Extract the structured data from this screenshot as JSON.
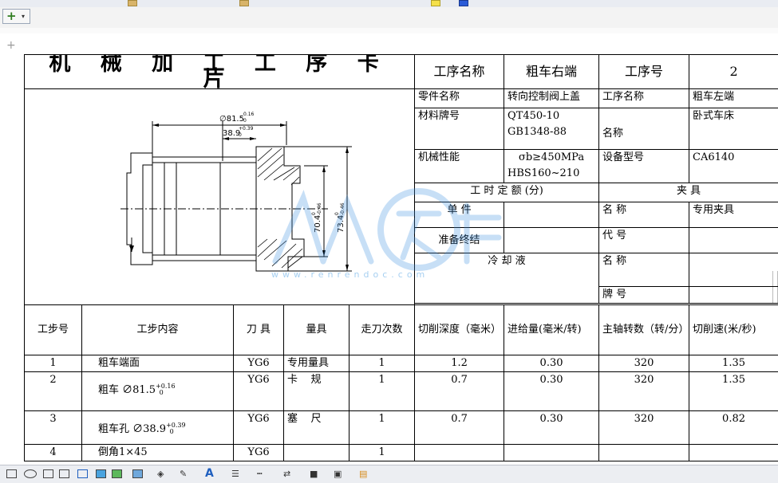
{
  "toolbar": {
    "add_label": "+",
    "dropdown_caret": "▾"
  },
  "card": {
    "title": "机 械 加 工 工 序 卡 片",
    "header": {
      "proc_name_label": "工序名称",
      "proc_name_value": "粗车右端",
      "proc_no_label": "工序号",
      "proc_no_value": "2"
    },
    "rows": {
      "part_name_label": "零件名称",
      "part_name_value": "转向控制阀上盖",
      "proc_name2_label": "工序名称",
      "proc_name2_value": "粗车左端",
      "material_label": "材料牌号",
      "material_value1": "QT450-10",
      "material_value2": "GB1348-88",
      "name_label": "名称",
      "name_value": "卧式车床",
      "mech_label": "机械性能",
      "mech_value1": "σb≥450MPa",
      "mech_value2": "HBS160~210",
      "equip_label": "设备型号",
      "equip_value": "CA6140",
      "time_quota": "工 时 定 额 (分)",
      "fixture": "夹 具",
      "unit_label": "单 件",
      "fixture_name_label": "名 称",
      "fixture_name_value": "专用夹具",
      "prep_label": "准备终结",
      "code_label": "代 号",
      "coolant_label": "冷 却 液",
      "name3_label": "名 称",
      "brand_label": "牌 号"
    },
    "drawing": {
      "dim_outer": "∅81.5",
      "dim_outer_tol": "0.16",
      "dim_outer_tol_low": "0",
      "dim_bore": "38.9",
      "dim_bore_tol": "+0.39",
      "dim_bore_tol_low": "0",
      "dim_h1": "70.4",
      "dim_h1_tol": "-0.46",
      "dim_h2": "73.4",
      "dim_h2_tol": "-0.46",
      "dim_tol_low": "0"
    },
    "step_headers": [
      "工步号",
      "工步内容",
      "刀 具",
      "量具",
      "走刀次数",
      "切削深度（毫米）",
      "进给量(毫米/转)",
      "主轴转数（转/分）",
      "切削速(米/秒)"
    ],
    "steps": [
      {
        "no": "1",
        "content": "粗车端面",
        "tol": "",
        "tol_low": "",
        "tool": "YG6",
        "gauge": "专用量具",
        "passes": "1",
        "depth": "1.2",
        "feed": "0.30",
        "rpm": "320",
        "speed": "1.35"
      },
      {
        "no": "2",
        "content": "粗车 ∅81.5",
        "tol": "+0.16",
        "tol_low": "0",
        "tool": "YG6",
        "gauge": "卡    规",
        "passes": "1",
        "depth": "0.7",
        "feed": "0.30",
        "rpm": "320",
        "speed": "1.35"
      },
      {
        "no": "3",
        "content": "粗车孔 ∅38.9",
        "tol": "+0.39",
        "tol_low": "0",
        "tool": "YG6",
        "gauge": "塞    尺",
        "passes": "1",
        "depth": "0.7",
        "feed": "0.30",
        "rpm": "320",
        "speed": "0.82"
      },
      {
        "no": "4",
        "content": "倒角1×45",
        "tol": "",
        "tol_low": "",
        "tool": "YG6",
        "gauge": "",
        "passes": "1",
        "depth": "",
        "feed": "",
        "rpm": "",
        "speed": ""
      }
    ]
  },
  "watermark": {
    "url": "www.renrendoc.com"
  },
  "bottom_toolbar": {
    "text_color_label": "A",
    "brand_color": "#1f5fbf"
  }
}
